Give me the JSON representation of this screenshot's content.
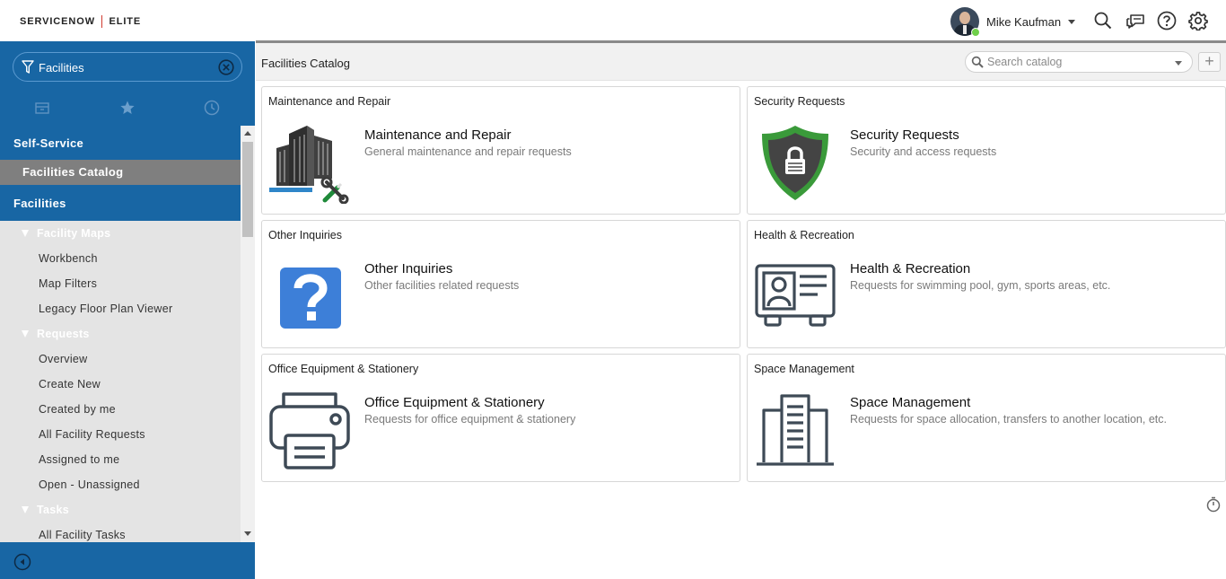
{
  "header": {
    "logo_left": "SERVICENOW",
    "logo_right": "ELITE",
    "user_name": "Mike Kaufman",
    "icons": [
      "search-icon",
      "chat-icon",
      "help-icon",
      "gear-icon"
    ]
  },
  "sidebar": {
    "filter_value": "Facilities",
    "tabs": [
      "archive-icon",
      "star-icon",
      "clock-icon"
    ],
    "app1": "Self-Service",
    "app1_active": "Facilities Catalog",
    "app2": "Facilities",
    "sections": [
      {
        "label": "Facility Maps",
        "items": [
          "Workbench",
          "Map Filters",
          "Legacy Floor Plan Viewer"
        ]
      },
      {
        "label": "Requests",
        "items": [
          "Overview",
          "Create New",
          "Created by me",
          "All Facility Requests",
          "Assigned to me",
          "Open - Unassigned"
        ]
      },
      {
        "label": "Tasks",
        "items": [
          "All Facility Tasks"
        ]
      }
    ]
  },
  "main": {
    "catalog_title": "Facilities Catalog",
    "search_placeholder": "Search catalog",
    "add_label": "+",
    "cards": [
      {
        "header": "Maintenance and Repair",
        "title": "Maintenance and Repair",
        "desc": "General maintenance and repair requests",
        "icon": "building-tools-icon"
      },
      {
        "header": "Security Requests",
        "title": "Security Requests",
        "desc": "Security and access requests",
        "icon": "shield-lock-icon"
      },
      {
        "header": "Other Inquiries",
        "title": "Other Inquiries",
        "desc": "Other facilities related requests",
        "icon": "question-icon"
      },
      {
        "header": "Health & Recreation",
        "title": "Health & Recreation",
        "desc": "Requests for swimming pool, gym, sports areas, etc.",
        "icon": "id-card-icon"
      },
      {
        "header": "Office Equipment & Stationery",
        "title": "Office Equipment & Stationery",
        "desc": "Requests for office equipment & stationery",
        "icon": "printer-icon"
      },
      {
        "header": "Space Management",
        "title": "Space Management",
        "desc": "Requests for space allocation, transfers to another location, etc.",
        "icon": "office-building-icon"
      }
    ]
  },
  "colors": {
    "brand_blue": "#1866a4",
    "active_gray": "#7f7f7f",
    "shield_green": "#3a9a3a",
    "question_blue": "#3d7fd8",
    "icon_slate": "#3e4a56"
  }
}
